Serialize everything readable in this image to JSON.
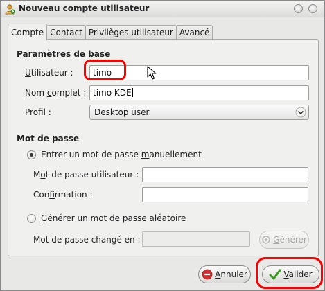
{
  "window": {
    "title": "Nouveau compte utilisateur"
  },
  "tabs": [
    {
      "label": "Compte",
      "active": true
    },
    {
      "label": "Contact",
      "active": false
    },
    {
      "label": "Privilèges utilisateur",
      "active": false
    },
    {
      "label": "Avancé",
      "active": false
    }
  ],
  "basic": {
    "section_title": "Paramètres de base",
    "username_label_underlined": "U",
    "username_label_rest": "tilisateur :",
    "username_value": "timo",
    "fullname_label_pre": "Nom ",
    "fullname_label_underlined": "c",
    "fullname_label_post": "omplet :",
    "fullname_value": "timo KDE",
    "profile_label_underlined": "P",
    "profile_label_rest": "rofil :",
    "profile_value": "Desktop user"
  },
  "password": {
    "section_title": "Mot de passe",
    "manual_option_pre": "Entrer un mot de passe ",
    "manual_option_underlined": "m",
    "manual_option_post": "anuellement",
    "manual_selected": true,
    "user_password_label_pre": "M",
    "user_password_label_underlined": "o",
    "user_password_label_post": "t de passe utilisateur :",
    "user_password_value": "",
    "confirm_label_pre": "Con",
    "confirm_label_underlined": "f",
    "confirm_label_post": "irmation :",
    "confirm_value": "",
    "random_option_underlined": "G",
    "random_option_rest": "énérer un mot de passe aléatoire",
    "changed_label": "Mot de passe changé en :",
    "changed_value": "",
    "generate_button_underlined": "G",
    "generate_button_rest": "énérer"
  },
  "buttons": {
    "cancel_underlined": "A",
    "cancel_rest": "nnuler",
    "ok_underlined": "V",
    "ok_rest": "alider"
  },
  "colors": {
    "highlight": "#ff0000",
    "ok_check": "#3a9a1e",
    "cancel_icon": "#c62828"
  },
  "icons": {
    "app": "user-icon",
    "cancel": "cancel-icon",
    "ok": "checkmark-icon",
    "generate": "generate-icon",
    "cursor": "mouse-pointer-icon"
  }
}
